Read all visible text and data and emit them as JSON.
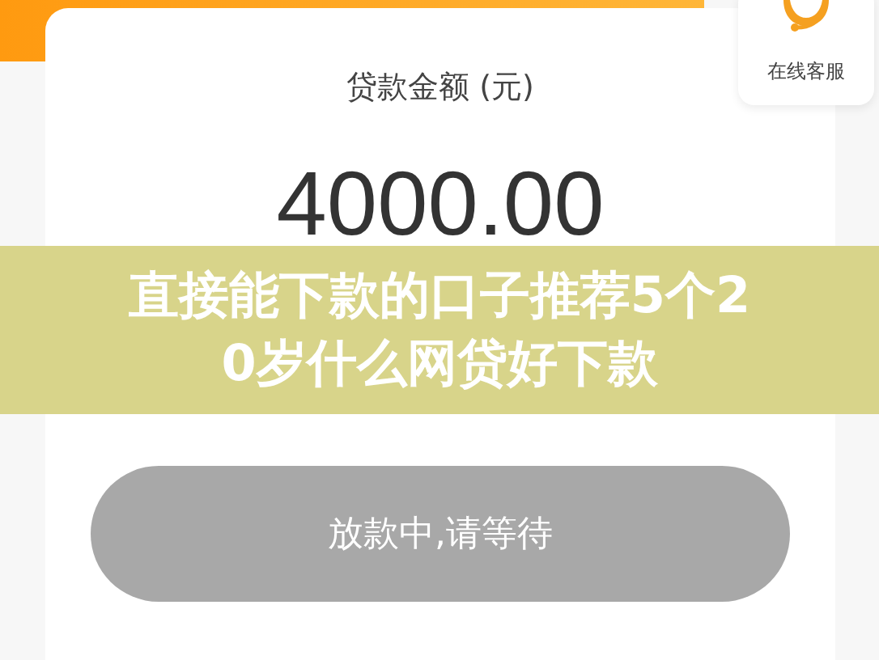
{
  "customer_service": {
    "label": "在线客服"
  },
  "loan": {
    "amount_label": "贷款金额 (元)",
    "amount": "4000.00"
  },
  "action_button": {
    "label": "放款中,请等待",
    "disabled": true
  },
  "title_banner": {
    "text": "直接能下款的口子推荐5个20岁什么网贷好下款"
  }
}
